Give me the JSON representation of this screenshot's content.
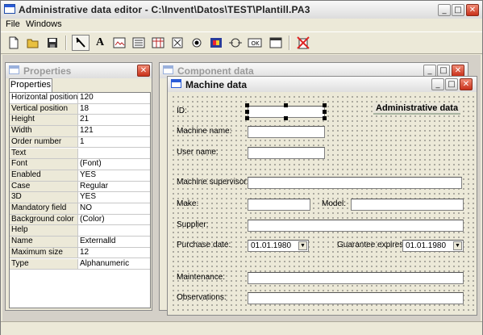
{
  "window": {
    "title": "Administrative data editor - C:\\Invent\\Datos\\TEST\\Plantill.PA3"
  },
  "menu": [
    "File",
    "Windows"
  ],
  "toolbar": {
    "buttons": [
      "new-file",
      "open-folder",
      "save",
      "pointer",
      "text-label",
      "image",
      "list",
      "table",
      "checkbox",
      "radio",
      "color-image",
      "rotate-link",
      "ok-button",
      "window",
      "delete"
    ],
    "text_tool_glyph": "A"
  },
  "properties": {
    "title": "Properties",
    "tab": "Properties",
    "rows": [
      {
        "name": "Horizontal position",
        "value": "120"
      },
      {
        "name": "Vertical position",
        "value": "18"
      },
      {
        "name": "Height",
        "value": "21"
      },
      {
        "name": "Width",
        "value": "121"
      },
      {
        "name": "Order number",
        "value": "1"
      },
      {
        "name": "Text",
        "value": ""
      },
      {
        "name": "Font",
        "value": "(Font)"
      },
      {
        "name": "Enabled",
        "value": "YES"
      },
      {
        "name": "Case",
        "value": "Regular"
      },
      {
        "name": "3D",
        "value": "YES"
      },
      {
        "name": "Mandatory field",
        "value": "NO"
      },
      {
        "name": "Background color",
        "value": "(Color)"
      },
      {
        "name": "Help",
        "value": ""
      },
      {
        "name": "Name",
        "value": "Externalld"
      },
      {
        "name": "Maximum size",
        "value": "12"
      },
      {
        "name": "Type",
        "value": "Alphanumeric"
      }
    ]
  },
  "component": {
    "title": "Component data"
  },
  "machine": {
    "title": "Machine data",
    "heading": "Administrative data",
    "labels": {
      "id": "ID:",
      "machine_name": "Machine name:",
      "user_name": "User name:",
      "supervisor": "Machine supervisor:",
      "make": "Make:",
      "model": "Model:",
      "supplier": "Supplier:",
      "purchase_date": "Purchase date:",
      "guarantee": "Guarantee expires:",
      "maintenance": "Maintenance:",
      "observations": "Observations:"
    },
    "values": {
      "purchase_date": "01.01.1980",
      "guarantee": "01.01.1980"
    }
  },
  "colors": {
    "accent": "#2a5bd7",
    "close": "#c8301a",
    "heading_bg": "#e7e4d9"
  }
}
